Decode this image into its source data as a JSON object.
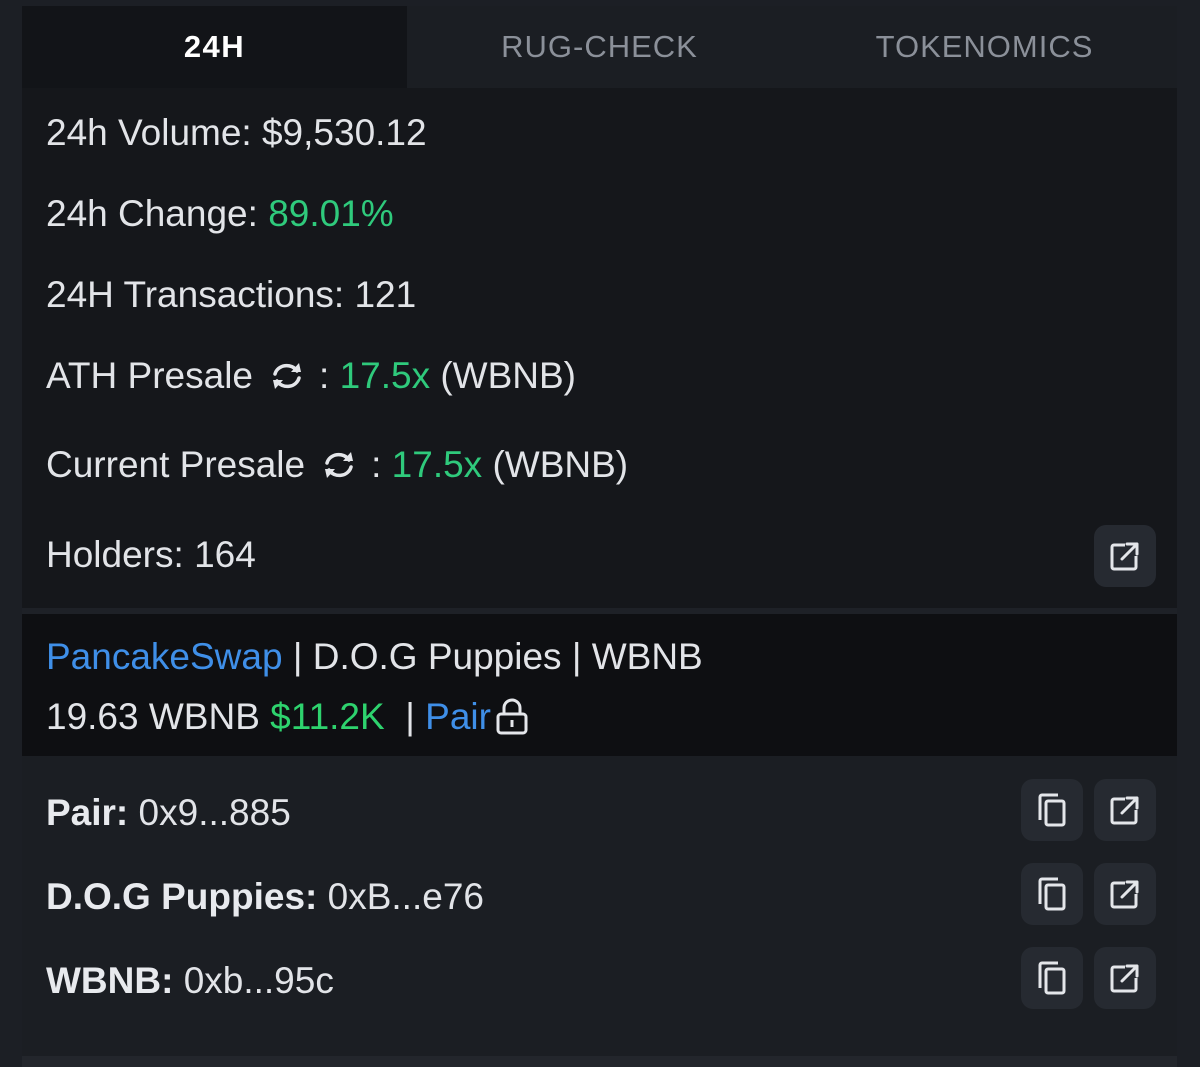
{
  "tabs": [
    {
      "label": "24H",
      "active": true
    },
    {
      "label": "RUG-CHECK",
      "active": false
    },
    {
      "label": "TOKENOMICS",
      "active": false
    }
  ],
  "stats": {
    "volume_label": "24h Volume: ",
    "volume_value": "$9,530.12",
    "change_label": "24h Change: ",
    "change_value": "89.01%",
    "tx_label": "24H Transactions: ",
    "tx_value": "121",
    "ath_label": "ATH Presale",
    "ath_sep": ": ",
    "ath_value": "17.5x",
    "ath_unit": "(WBNB)",
    "current_label": "Current Presale",
    "current_sep": ": ",
    "current_value": "17.5x",
    "current_unit": "(WBNB)",
    "holders_label": "Holders: ",
    "holders_value": "164"
  },
  "pair": {
    "dex": "PancakeSwap",
    "sep1": " | ",
    "token": "D.O.G Puppies",
    "sep2": " | ",
    "quote": "WBNB",
    "liquidity_amount": "19.63 WBNB",
    "liquidity_usd": "$11.2K",
    "sep3": "|",
    "pair_link": "Pair"
  },
  "addresses": [
    {
      "label": "Pair:",
      "value": "0x9...885"
    },
    {
      "label": "D.O.G Puppies:",
      "value": "0xB...e76"
    },
    {
      "label": "WBNB:",
      "value": "0xb...95c"
    }
  ],
  "icons": {
    "refresh": "refresh-icon",
    "external": "external-link-icon",
    "copy": "copy-icon",
    "lock": "lock-icon"
  },
  "colors": {
    "green": "#2fca7c",
    "link": "#3f8fe8",
    "background": "#15171b"
  }
}
